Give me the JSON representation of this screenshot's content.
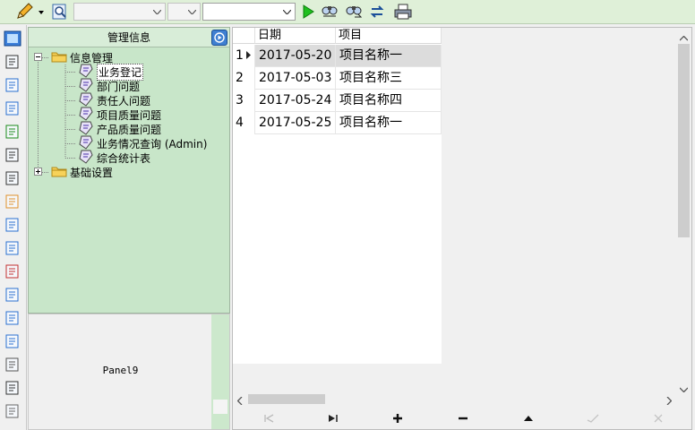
{
  "toolbar": {
    "buttons": [
      {
        "icon": "pencil-dropdown-icon"
      },
      {
        "icon": "search-icon"
      },
      {
        "icon": "run-icon"
      },
      {
        "icon": "find-icon"
      },
      {
        "icon": "find-next-icon"
      },
      {
        "icon": "refresh-icon"
      },
      {
        "icon": "print-icon"
      }
    ],
    "combo1_value": "",
    "combo2_value": "",
    "combo3_value": ""
  },
  "sidebar_icons": [
    "form-icon",
    "tree-icon",
    "list-icon",
    "doc-icon",
    "chart-icon",
    "mail-icon",
    "export-icon",
    "copy-icon",
    "edit-icon",
    "users-icon",
    "link-icon",
    "report-icon",
    "page-icon",
    "table-icon",
    "grid-icon",
    "settings-icon",
    "trash-icon"
  ],
  "tree": {
    "header": "管理信息",
    "nodes": [
      {
        "label": "信息管理",
        "level": 0,
        "expanded": true
      },
      {
        "label": "业务登记",
        "level": 1,
        "selected": true
      },
      {
        "label": "部门问题",
        "level": 1
      },
      {
        "label": "责任人问题",
        "level": 1
      },
      {
        "label": "项目质量问题",
        "level": 1
      },
      {
        "label": "产品质量问题",
        "level": 1
      },
      {
        "label": "业务情况查询 (Admin)",
        "level": 1
      },
      {
        "label": "综合统计表",
        "level": 1
      },
      {
        "label": "基础设置",
        "level": 0,
        "expanded": false
      }
    ]
  },
  "panel9": {
    "caption": "Panel9"
  },
  "grid": {
    "columns": [
      "日期",
      "项目"
    ],
    "rows": [
      {
        "num": "1",
        "date": "2017-05-20",
        "item": "项目名称一",
        "current": true
      },
      {
        "num": "2",
        "date": "2017-05-03",
        "item": "项目名称三"
      },
      {
        "num": "3",
        "date": "2017-05-24",
        "item": "项目名称四"
      },
      {
        "num": "4",
        "date": "2017-05-25",
        "item": "项目名称一"
      }
    ]
  },
  "navigator": [
    "first-icon",
    "last-icon",
    "insert-icon",
    "delete-icon",
    "edit-icon",
    "post-icon",
    "cancel-icon"
  ],
  "colors": {
    "toolbar_bg": "#dff0d8",
    "tree_bg": "#c8e6c9",
    "selected_row": "#dcdcdc"
  }
}
